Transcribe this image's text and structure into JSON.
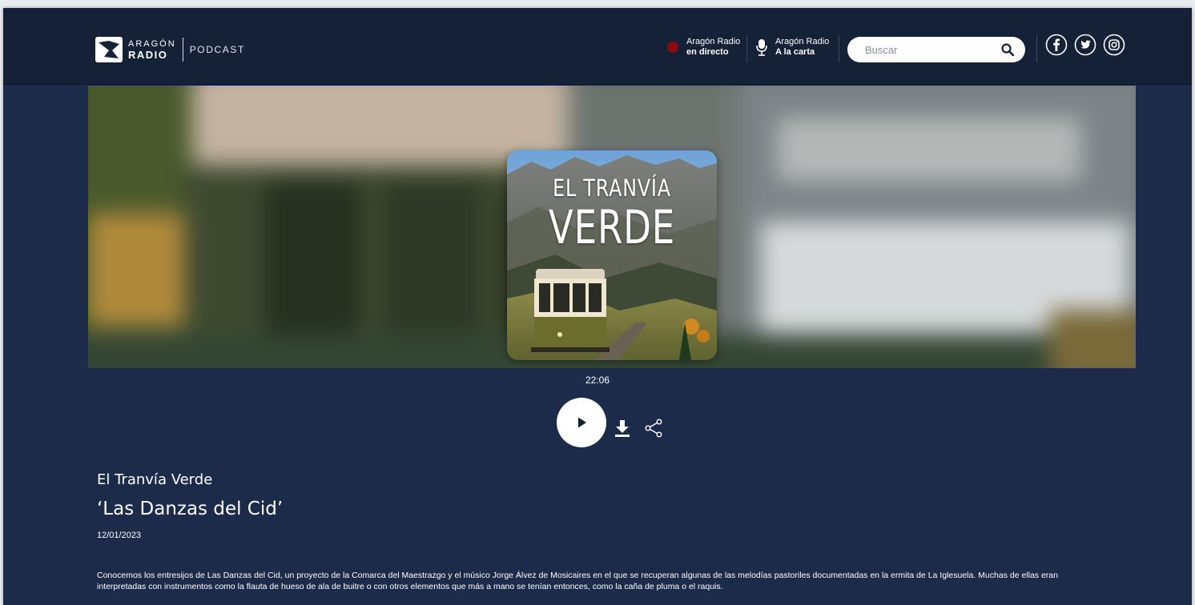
{
  "header": {
    "logo": {
      "line1": "ARAGÓN",
      "line2": "RADIO",
      "section": "PODCAST"
    },
    "live": {
      "line1": "Aragón Radio",
      "line2": "en directo"
    },
    "alacarta": {
      "line1": "Aragón Radio",
      "line2": "A la carta"
    },
    "search": {
      "placeholder": "Buscar"
    },
    "social": [
      "facebook-icon",
      "twitter-icon",
      "instagram-icon"
    ]
  },
  "cover": {
    "line1": "EL TRANVÍA",
    "line2": "VERDE"
  },
  "player": {
    "duration": "22:06"
  },
  "episode": {
    "program": "El Tranvía Verde",
    "title": "‘Las Danzas del Cid’",
    "date": "12/01/2023",
    "description": "Conocemos los entresijos de Las Danzas del Cid, un proyecto de la Comarca del Maestrazgo y el músico Jorge Álvez de Mosicaires en el que se recuperan algunas de las melodías pastoriles documentadas en la ermita de La Iglesuela. Muchas de ellas eran interpretadas con instrumentos como la flauta de hueso de ala de buitre o con otros elementos que más a mano se tenían entonces, como la caña de pluma o el raquis."
  },
  "colors": {
    "header_bg": "#152136",
    "page_bg": "#1c2b4a",
    "live_dot": "#8b0a14",
    "accent": "#ffffff"
  }
}
